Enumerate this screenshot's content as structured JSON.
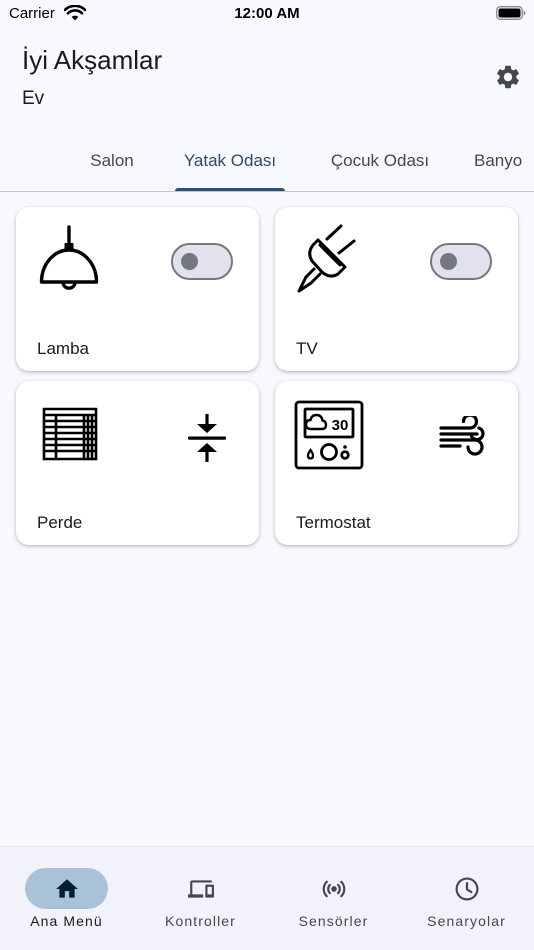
{
  "status_bar": {
    "carrier": "Carrier",
    "time": "12:00 AM"
  },
  "header": {
    "greeting": "İyi Akşamlar",
    "home": "Ev"
  },
  "tabs": [
    {
      "label": "Salon",
      "active": false
    },
    {
      "label": "Yatak Odası",
      "active": true
    },
    {
      "label": "Çocuk Odası",
      "active": false
    },
    {
      "label": "Banyo",
      "active": false
    }
  ],
  "devices": [
    {
      "label": "Lamba",
      "icon": "ceiling-lamp-icon",
      "control": "toggle",
      "state": "off"
    },
    {
      "label": "TV",
      "icon": "power-plug-icon",
      "control": "toggle",
      "state": "off"
    },
    {
      "label": "Perde",
      "icon": "window-blinds-icon",
      "control": "compress-icon"
    },
    {
      "label": "Termostat",
      "icon": "thermostat-icon",
      "control": "wind-icon",
      "display_value": "30"
    }
  ],
  "bottom_nav": [
    {
      "label": "Ana Menü",
      "icon": "home-icon",
      "active": true
    },
    {
      "label": "Kontroller",
      "icon": "devices-icon",
      "active": false
    },
    {
      "label": "Sensörler",
      "icon": "sensors-icon",
      "active": false
    },
    {
      "label": "Senaryolar",
      "icon": "clock-icon",
      "active": false
    }
  ],
  "colors": {
    "background": "#f8f9fe",
    "active_tab_indicator": "#2d5478",
    "nav_active_pill": "#a9c2d8",
    "toggle_off": "#74777f"
  }
}
